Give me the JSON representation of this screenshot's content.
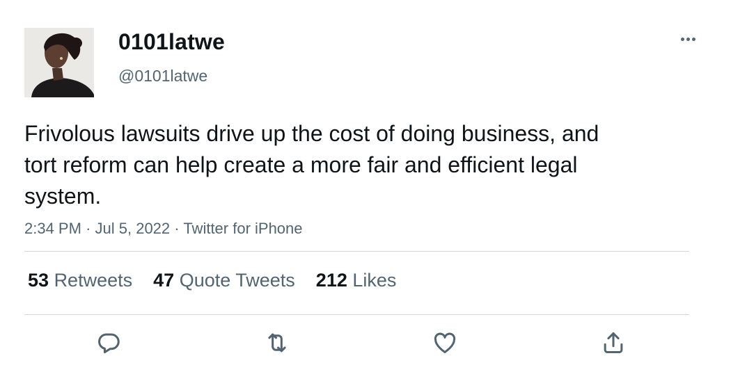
{
  "user": {
    "display_name": "0101latwe",
    "handle": "@0101latwe"
  },
  "tweet": {
    "text": "Frivolous lawsuits drive up the cost of doing business, and tort reform can help create a more fair and efficient legal system.",
    "time": "2:34 PM",
    "date": "Jul 5, 2022",
    "source": "Twitter for iPhone",
    "separator": "·"
  },
  "stats": {
    "retweets": {
      "count": "53",
      "label": "Retweets"
    },
    "quote_tweets": {
      "count": "47",
      "label": "Quote Tweets"
    },
    "likes": {
      "count": "212",
      "label": "Likes"
    }
  },
  "icons": {
    "more": "more-horizontal-icon",
    "reply": "reply-icon",
    "retweet": "retweet-icon",
    "like": "heart-icon",
    "share": "share-icon"
  },
  "colors": {
    "text_primary": "#0f1419",
    "text_secondary": "#536471",
    "divider": "#cfd9de"
  }
}
